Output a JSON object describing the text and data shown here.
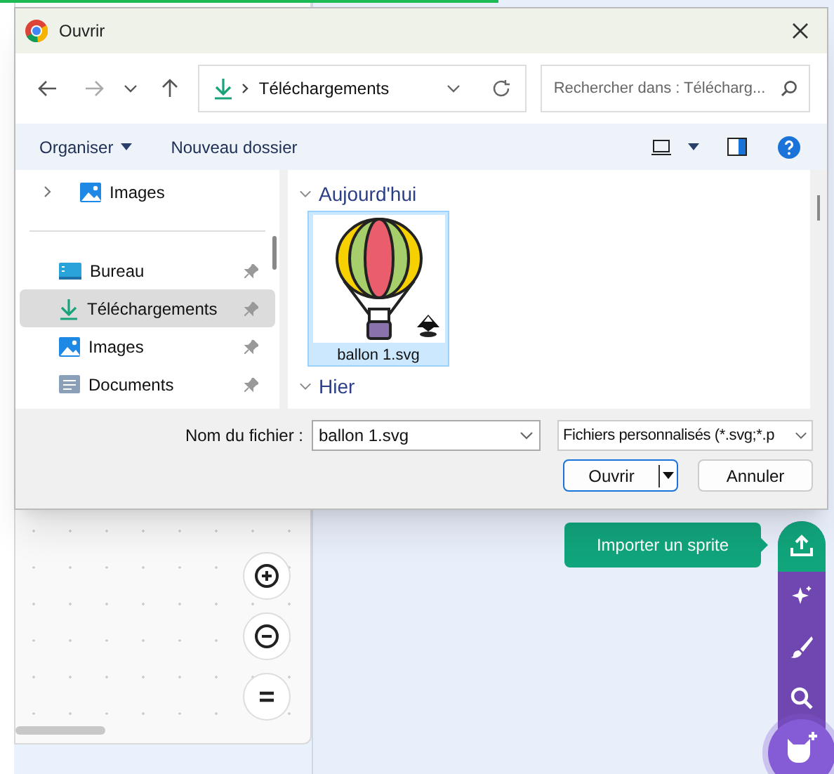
{
  "window": {
    "title": "Ouvrir"
  },
  "navigation": {
    "address": "Téléchargements",
    "search_placeholder": "Rechercher dans : Télécharg..."
  },
  "command_bar": {
    "items": [
      "Organiser",
      "Nouveau dossier"
    ]
  },
  "nav_pane": {
    "items": [
      {
        "kind": "tree",
        "label": "Images",
        "selected": false
      },
      {
        "kind": "divider"
      },
      {
        "kind": "pinned",
        "label": "Bureau",
        "selected": false
      },
      {
        "kind": "pinned",
        "label": "Téléchargements",
        "selected": true
      },
      {
        "kind": "pinned",
        "label": "Images",
        "selected": false
      },
      {
        "kind": "pinned",
        "label": "Documents",
        "selected": false
      }
    ]
  },
  "groups": [
    {
      "label": "Aujourd'hui",
      "expanded": true,
      "files": [
        {
          "name": "ballon 1.svg",
          "selected": true
        }
      ]
    },
    {
      "label": "Hier",
      "expanded": true
    }
  ],
  "footer": {
    "filename_label": "Nom du fichier :",
    "filename": "ballon 1.svg",
    "filetype": "Fichiers personnalisés (*.svg;*.p",
    "buttons": [
      {
        "label": "Ouvrir",
        "kind": "split"
      },
      {
        "label": "Annuler",
        "kind": "plain"
      }
    ]
  },
  "editor": {
    "tooltip": "Importer un sprite",
    "sprite_menu": [
      {
        "kind": "upload",
        "selected": true
      },
      {
        "kind": "surprise",
        "selected": false
      },
      {
        "kind": "paint",
        "selected": false
      },
      {
        "kind": "search",
        "selected": false
      }
    ]
  }
}
